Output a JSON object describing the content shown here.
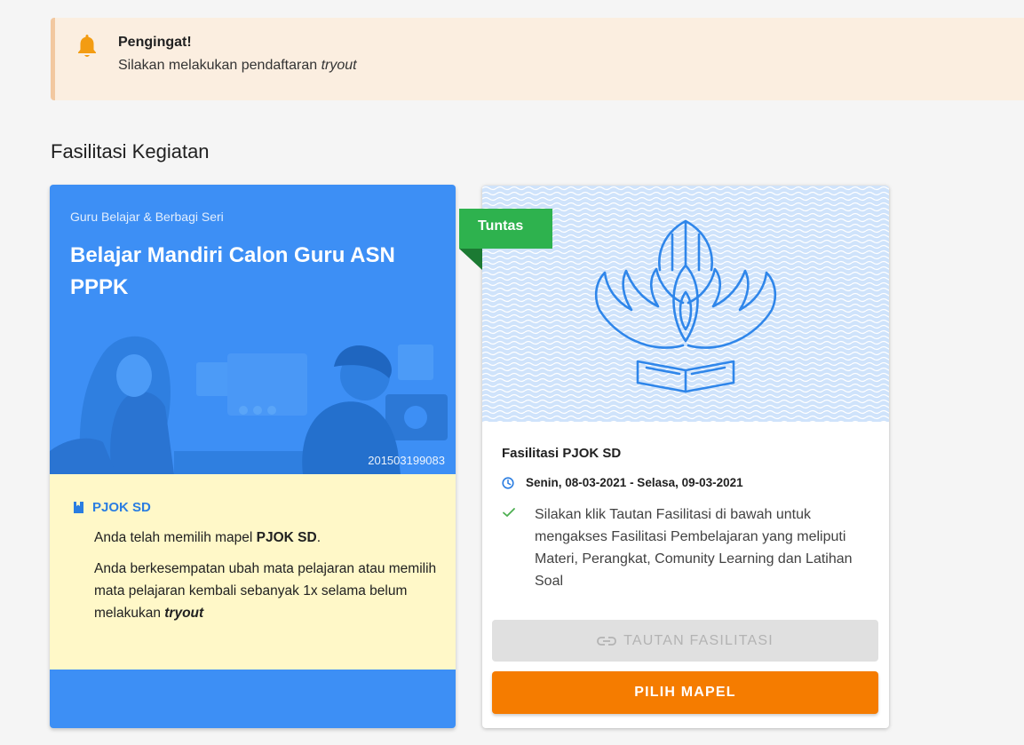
{
  "alert": {
    "title": "Pengingat!",
    "text_prefix": "Silakan melakukan pendaftaran ",
    "text_emphasis": "tryout",
    "icon": "bell-icon"
  },
  "section": {
    "title": "Fasilitasi Kegiatan"
  },
  "course_card": {
    "series": "Guru Belajar & Berbagi Seri",
    "title": "Belajar Mandiri Calon Guru ASN PPPK",
    "id_number": "201503199083",
    "subject_label": "PJOK SD",
    "selected_prefix": "Anda telah memilih mapel ",
    "selected_subject": "PJOK SD",
    "selected_suffix": ".",
    "change_note": "Anda berkesempatan ubah mata pelajaran atau memilih mata pelajaran kembali sebanyak 1x selama belum melakukan ",
    "change_note_emphasis": "tryout"
  },
  "facility_card": {
    "status_badge": "Tuntas",
    "title": "Fasilitasi PJOK SD",
    "date_range": "Senin, 08-03-2021 - Selasa, 09-03-2021",
    "description": "Silakan klik Tautan Fasilitasi di bawah untuk mengakses Fasilitasi Pembelajaran yang meliputi Materi, Perangkat, Comunity Learning dan Latihan Soal",
    "link_button": "TAUTAN FASILITASI",
    "choose_button": "PILIH MAPEL"
  },
  "colors": {
    "alert_bg": "#fbeee0",
    "blue_card": "#3d8ff5",
    "info_bg": "#fff8c8",
    "badge_green": "#2eb24e",
    "primary_orange": "#f57c00",
    "disabled_gray": "#e0e0e0"
  }
}
